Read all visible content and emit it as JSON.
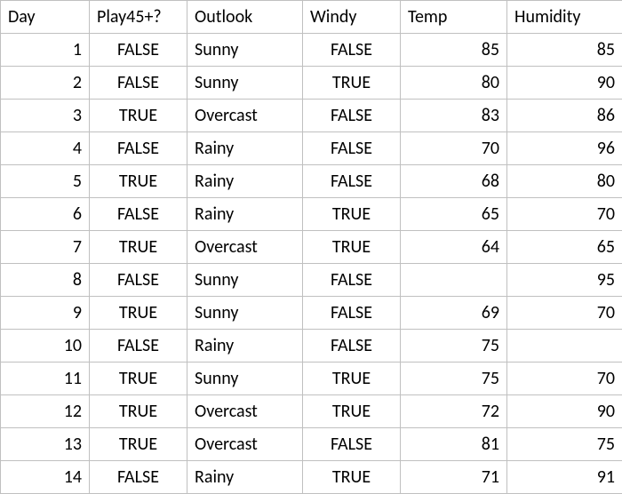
{
  "table": {
    "headers": [
      "Day",
      "Play45+?",
      "Outlook",
      "Windy",
      "Temp",
      "Humidity"
    ],
    "rows": [
      {
        "day": "1",
        "play": "FALSE",
        "outlook": "Sunny",
        "windy": "FALSE",
        "temp": "85",
        "humidity": "85"
      },
      {
        "day": "2",
        "play": "FALSE",
        "outlook": "Sunny",
        "windy": "TRUE",
        "temp": "80",
        "humidity": "90"
      },
      {
        "day": "3",
        "play": "TRUE",
        "outlook": "Overcast",
        "windy": "FALSE",
        "temp": "83",
        "humidity": "86"
      },
      {
        "day": "4",
        "play": "FALSE",
        "outlook": "Rainy",
        "windy": "FALSE",
        "temp": "70",
        "humidity": "96"
      },
      {
        "day": "5",
        "play": "TRUE",
        "outlook": "Rainy",
        "windy": "FALSE",
        "temp": "68",
        "humidity": "80"
      },
      {
        "day": "6",
        "play": "FALSE",
        "outlook": "Rainy",
        "windy": "TRUE",
        "temp": "65",
        "humidity": "70"
      },
      {
        "day": "7",
        "play": "TRUE",
        "outlook": "Overcast",
        "windy": "TRUE",
        "temp": "64",
        "humidity": "65"
      },
      {
        "day": "8",
        "play": "FALSE",
        "outlook": "Sunny",
        "windy": "FALSE",
        "temp": "",
        "humidity": "95"
      },
      {
        "day": "9",
        "play": "TRUE",
        "outlook": "Sunny",
        "windy": "FALSE",
        "temp": "69",
        "humidity": "70"
      },
      {
        "day": "10",
        "play": "FALSE",
        "outlook": "Rainy",
        "windy": "FALSE",
        "temp": "75",
        "humidity": ""
      },
      {
        "day": "11",
        "play": "TRUE",
        "outlook": "Sunny",
        "windy": "TRUE",
        "temp": "75",
        "humidity": "70"
      },
      {
        "day": "12",
        "play": "TRUE",
        "outlook": "Overcast",
        "windy": "TRUE",
        "temp": "72",
        "humidity": "90"
      },
      {
        "day": "13",
        "play": "TRUE",
        "outlook": "Overcast",
        "windy": "FALSE",
        "temp": "81",
        "humidity": "75"
      },
      {
        "day": "14",
        "play": "FALSE",
        "outlook": "Rainy",
        "windy": "TRUE",
        "temp": "71",
        "humidity": "91"
      }
    ]
  }
}
